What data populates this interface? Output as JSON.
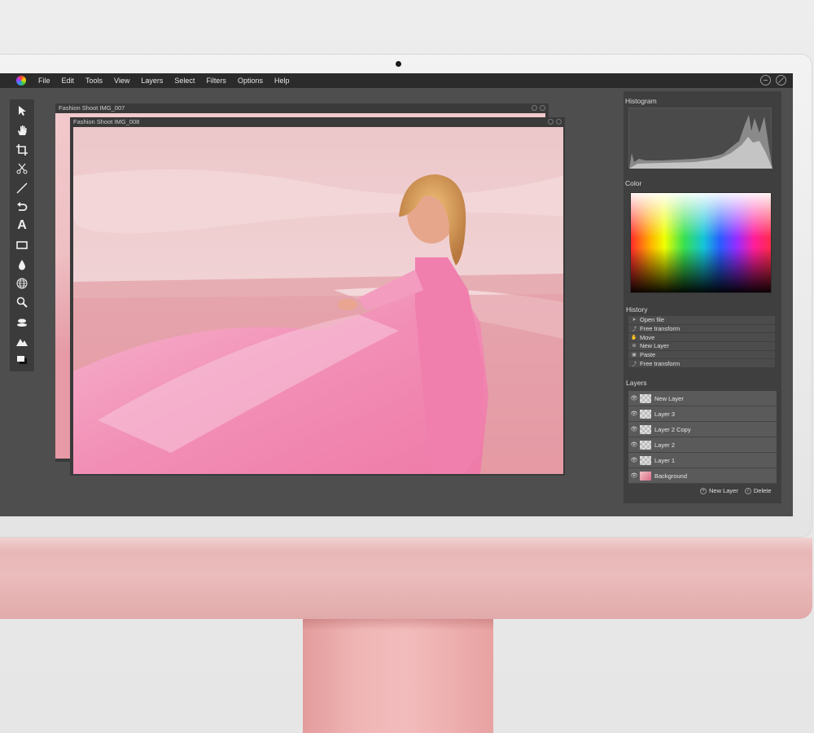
{
  "menubar": {
    "items": [
      "File",
      "Edit",
      "Tools",
      "View",
      "Layers",
      "Select",
      "Filters",
      "Options",
      "Help"
    ]
  },
  "toolbar": {
    "tools": [
      "arrow-icon",
      "hand-icon",
      "crop-icon",
      "scissors-icon",
      "line-icon",
      "undo-icon",
      "text-icon",
      "rectangle-icon",
      "drop-icon",
      "globe-icon",
      "zoom-icon",
      "smudge-icon",
      "mountain-icon",
      "color-swatch-icon"
    ]
  },
  "documents": {
    "back_title": "Fashion Shoot IMG_007",
    "front_title": "Fashion Shoot IMG_008"
  },
  "panels": {
    "histogram_label": "Histogram",
    "color_label": "Color",
    "history_label": "History",
    "layers_label": "Layers"
  },
  "history": [
    {
      "icon": "cursor-icon",
      "label": "Open file"
    },
    {
      "icon": "transform-icon",
      "label": "Free transform"
    },
    {
      "icon": "hand-icon",
      "label": "Move"
    },
    {
      "icon": "new-layer-icon",
      "label": "New Layer"
    },
    {
      "icon": "paste-icon",
      "label": "Paste"
    },
    {
      "icon": "transform-icon",
      "label": "Free transform"
    }
  ],
  "layers": [
    {
      "label": "New Layer"
    },
    {
      "label": "Layer 3"
    },
    {
      "label": "Layer 2 Copy"
    },
    {
      "label": "Layer 2"
    },
    {
      "label": "Layer 1"
    },
    {
      "label": "Background"
    }
  ],
  "layer_actions": {
    "new_label": "New Layer",
    "delete_label": "Delete"
  },
  "colors": {
    "screen_bg": "#4e4e4e",
    "menubar_bg": "#2b2b2b",
    "imac_pink": "#e8b0b0"
  }
}
